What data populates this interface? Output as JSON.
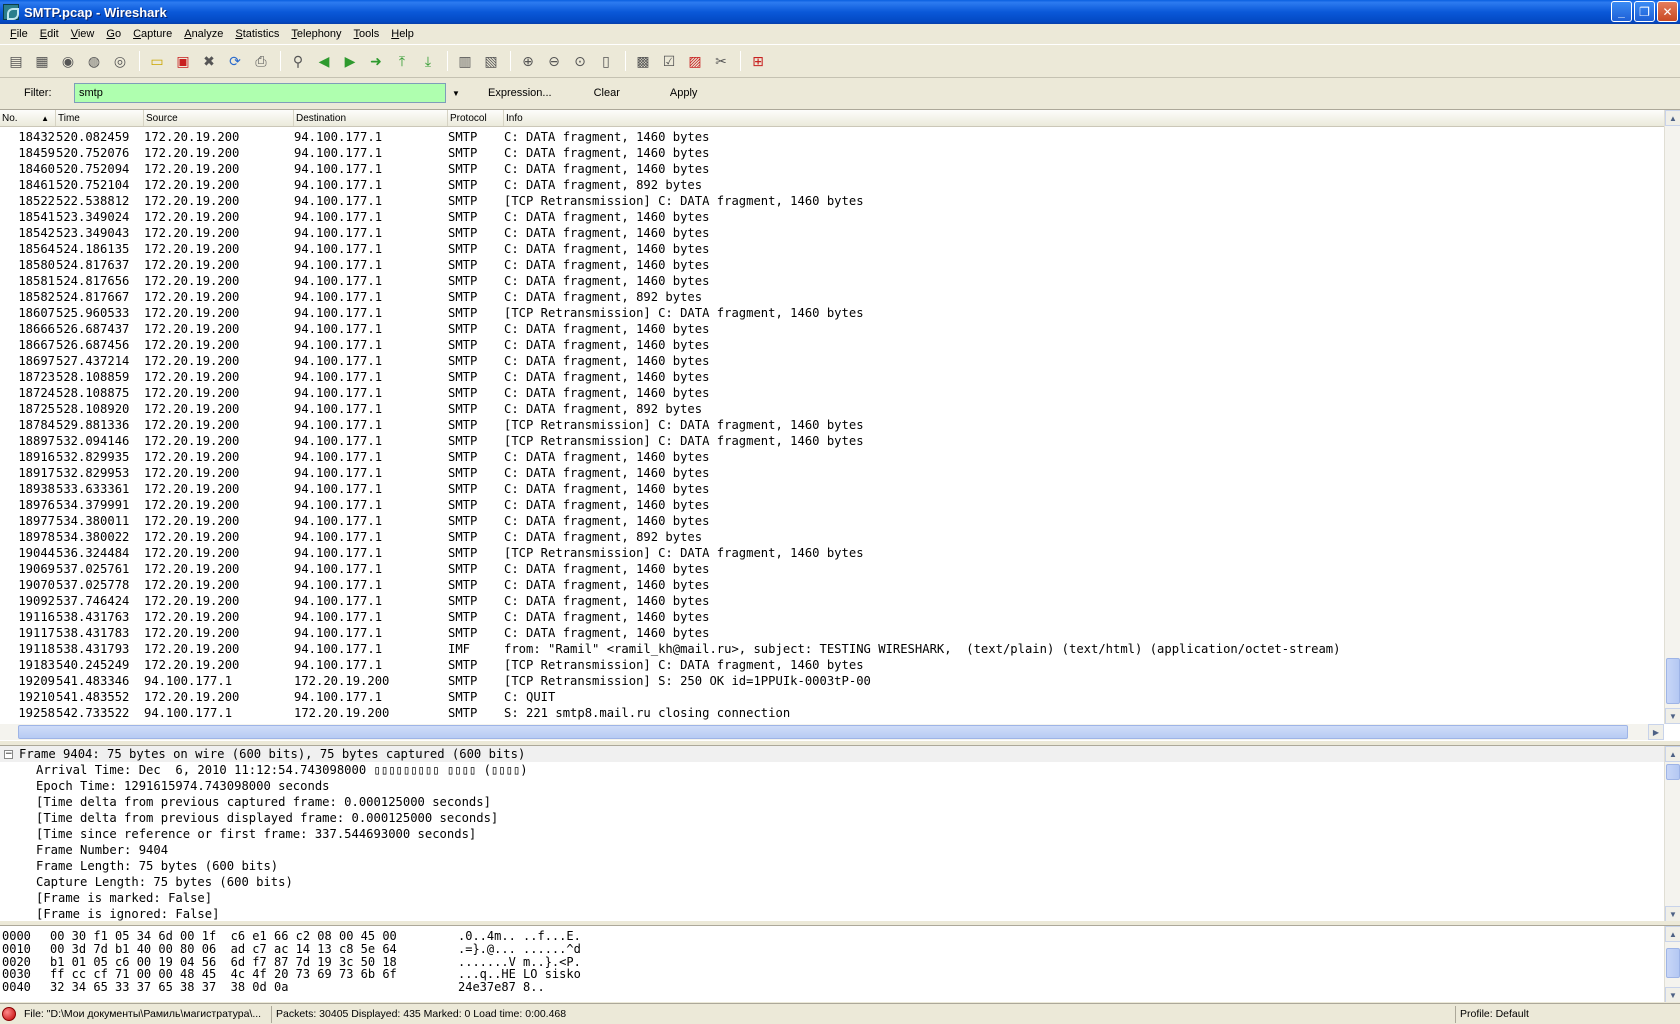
{
  "window": {
    "title": "SMTP.pcap - Wireshark"
  },
  "menu": [
    "File",
    "Edit",
    "View",
    "Go",
    "Capture",
    "Analyze",
    "Statistics",
    "Telephony",
    "Tools",
    "Help"
  ],
  "filter": {
    "label": "Filter:",
    "value": "smtp",
    "expression_label": "Expression...",
    "clear_label": "Clear",
    "apply_label": "Apply"
  },
  "columns": {
    "no": "No.",
    "time": "Time",
    "source": "Source",
    "destination": "Destination",
    "protocol": "Protocol",
    "info": "Info"
  },
  "packets": [
    [
      "18432",
      "520.082459",
      "172.20.19.200",
      "94.100.177.1",
      "SMTP",
      "C: DATA fragment, 1460 bytes"
    ],
    [
      "18459",
      "520.752076",
      "172.20.19.200",
      "94.100.177.1",
      "SMTP",
      "C: DATA fragment, 1460 bytes"
    ],
    [
      "18460",
      "520.752094",
      "172.20.19.200",
      "94.100.177.1",
      "SMTP",
      "C: DATA fragment, 1460 bytes"
    ],
    [
      "18461",
      "520.752104",
      "172.20.19.200",
      "94.100.177.1",
      "SMTP",
      "C: DATA fragment, 892 bytes"
    ],
    [
      "18522",
      "522.538812",
      "172.20.19.200",
      "94.100.177.1",
      "SMTP",
      "[TCP Retransmission] C: DATA fragment, 1460 bytes"
    ],
    [
      "18541",
      "523.349024",
      "172.20.19.200",
      "94.100.177.1",
      "SMTP",
      "C: DATA fragment, 1460 bytes"
    ],
    [
      "18542",
      "523.349043",
      "172.20.19.200",
      "94.100.177.1",
      "SMTP",
      "C: DATA fragment, 1460 bytes"
    ],
    [
      "18564",
      "524.186135",
      "172.20.19.200",
      "94.100.177.1",
      "SMTP",
      "C: DATA fragment, 1460 bytes"
    ],
    [
      "18580",
      "524.817637",
      "172.20.19.200",
      "94.100.177.1",
      "SMTP",
      "C: DATA fragment, 1460 bytes"
    ],
    [
      "18581",
      "524.817656",
      "172.20.19.200",
      "94.100.177.1",
      "SMTP",
      "C: DATA fragment, 1460 bytes"
    ],
    [
      "18582",
      "524.817667",
      "172.20.19.200",
      "94.100.177.1",
      "SMTP",
      "C: DATA fragment, 892 bytes"
    ],
    [
      "18607",
      "525.960533",
      "172.20.19.200",
      "94.100.177.1",
      "SMTP",
      "[TCP Retransmission] C: DATA fragment, 1460 bytes"
    ],
    [
      "18666",
      "526.687437",
      "172.20.19.200",
      "94.100.177.1",
      "SMTP",
      "C: DATA fragment, 1460 bytes"
    ],
    [
      "18667",
      "526.687456",
      "172.20.19.200",
      "94.100.177.1",
      "SMTP",
      "C: DATA fragment, 1460 bytes"
    ],
    [
      "18697",
      "527.437214",
      "172.20.19.200",
      "94.100.177.1",
      "SMTP",
      "C: DATA fragment, 1460 bytes"
    ],
    [
      "18723",
      "528.108859",
      "172.20.19.200",
      "94.100.177.1",
      "SMTP",
      "C: DATA fragment, 1460 bytes"
    ],
    [
      "18724",
      "528.108875",
      "172.20.19.200",
      "94.100.177.1",
      "SMTP",
      "C: DATA fragment, 1460 bytes"
    ],
    [
      "18725",
      "528.108920",
      "172.20.19.200",
      "94.100.177.1",
      "SMTP",
      "C: DATA fragment, 892 bytes"
    ],
    [
      "18784",
      "529.881336",
      "172.20.19.200",
      "94.100.177.1",
      "SMTP",
      "[TCP Retransmission] C: DATA fragment, 1460 bytes"
    ],
    [
      "18897",
      "532.094146",
      "172.20.19.200",
      "94.100.177.1",
      "SMTP",
      "[TCP Retransmission] C: DATA fragment, 1460 bytes"
    ],
    [
      "18916",
      "532.829935",
      "172.20.19.200",
      "94.100.177.1",
      "SMTP",
      "C: DATA fragment, 1460 bytes"
    ],
    [
      "18917",
      "532.829953",
      "172.20.19.200",
      "94.100.177.1",
      "SMTP",
      "C: DATA fragment, 1460 bytes"
    ],
    [
      "18938",
      "533.633361",
      "172.20.19.200",
      "94.100.177.1",
      "SMTP",
      "C: DATA fragment, 1460 bytes"
    ],
    [
      "18976",
      "534.379991",
      "172.20.19.200",
      "94.100.177.1",
      "SMTP",
      "C: DATA fragment, 1460 bytes"
    ],
    [
      "18977",
      "534.380011",
      "172.20.19.200",
      "94.100.177.1",
      "SMTP",
      "C: DATA fragment, 1460 bytes"
    ],
    [
      "18978",
      "534.380022",
      "172.20.19.200",
      "94.100.177.1",
      "SMTP",
      "C: DATA fragment, 892 bytes"
    ],
    [
      "19044",
      "536.324484",
      "172.20.19.200",
      "94.100.177.1",
      "SMTP",
      "[TCP Retransmission] C: DATA fragment, 1460 bytes"
    ],
    [
      "19069",
      "537.025761",
      "172.20.19.200",
      "94.100.177.1",
      "SMTP",
      "C: DATA fragment, 1460 bytes"
    ],
    [
      "19070",
      "537.025778",
      "172.20.19.200",
      "94.100.177.1",
      "SMTP",
      "C: DATA fragment, 1460 bytes"
    ],
    [
      "19092",
      "537.746424",
      "172.20.19.200",
      "94.100.177.1",
      "SMTP",
      "C: DATA fragment, 1460 bytes"
    ],
    [
      "19116",
      "538.431763",
      "172.20.19.200",
      "94.100.177.1",
      "SMTP",
      "C: DATA fragment, 1460 bytes"
    ],
    [
      "19117",
      "538.431783",
      "172.20.19.200",
      "94.100.177.1",
      "SMTP",
      "C: DATA fragment, 1460 bytes"
    ],
    [
      "19118",
      "538.431793",
      "172.20.19.200",
      "94.100.177.1",
      "IMF",
      "from: \"Ramil\" <ramil_kh@mail.ru>, subject: TESTING WIRESHARK,  (text/plain) (text/html) (application/octet-stream)"
    ],
    [
      "19183",
      "540.245249",
      "172.20.19.200",
      "94.100.177.1",
      "SMTP",
      "[TCP Retransmission] C: DATA fragment, 1460 bytes"
    ],
    [
      "19209",
      "541.483346",
      "94.100.177.1",
      "172.20.19.200",
      "SMTP",
      "[TCP Retransmission] S: 250 OK id=1PPUIk-0003tP-00"
    ],
    [
      "19210",
      "541.483552",
      "172.20.19.200",
      "94.100.177.1",
      "SMTP",
      "C: QUIT"
    ],
    [
      "19258",
      "542.733522",
      "94.100.177.1",
      "172.20.19.200",
      "SMTP",
      "S: 221 smtp8.mail.ru closing connection"
    ]
  ],
  "details": {
    "header": "Frame 9404: 75 bytes on wire (600 bits), 75 bytes captured (600 bits)",
    "lines": [
      "Arrival Time: Dec  6, 2010 11:12:54.743098000 ▯▯▯▯▯▯▯▯▯ ▯▯▯▯ (▯▯▯▯)",
      "Epoch Time: 1291615974.743098000 seconds",
      "[Time delta from previous captured frame: 0.000125000 seconds]",
      "[Time delta from previous displayed frame: 0.000125000 seconds]",
      "[Time since reference or first frame: 337.544693000 seconds]",
      "Frame Number: 9404",
      "Frame Length: 75 bytes (600 bits)",
      "Capture Length: 75 bytes (600 bits)",
      "[Frame is marked: False]",
      "[Frame is ignored: False]"
    ]
  },
  "bytes": [
    [
      "0000",
      "00 30 f1 05 34 6d 00 1f  c6 e1 66 c2 08 00 45 00",
      ".0..4m.. ..f...E."
    ],
    [
      "0010",
      "00 3d 7d b1 40 00 80 06  ad c7 ac 14 13 c8 5e 64",
      ".=}.@... ......^d"
    ],
    [
      "0020",
      "b1 01 05 c6 00 19 04 56  6d f7 87 7d 19 3c 50 18",
      ".......V m..}.<P."
    ],
    [
      "0030",
      "ff cc cf 71 00 00 48 45  4c 4f 20 73 69 73 6b 6f",
      "...q..HE LO sisko"
    ],
    [
      "0040",
      "32 34 65 33 37 65 38 37  38 0d 0a",
      "24e37e87 8.."
    ]
  ],
  "status": {
    "file": "File: \"D:\\Мои документы\\Рамиль\\магистратура\\...",
    "packets": "Packets: 30405 Displayed: 435 Marked: 0 Load time: 0:00.468",
    "profile": "Profile: Default"
  },
  "colors": {
    "filter_valid_bg": "#afffaf",
    "titlebar": "#0a58d8"
  }
}
